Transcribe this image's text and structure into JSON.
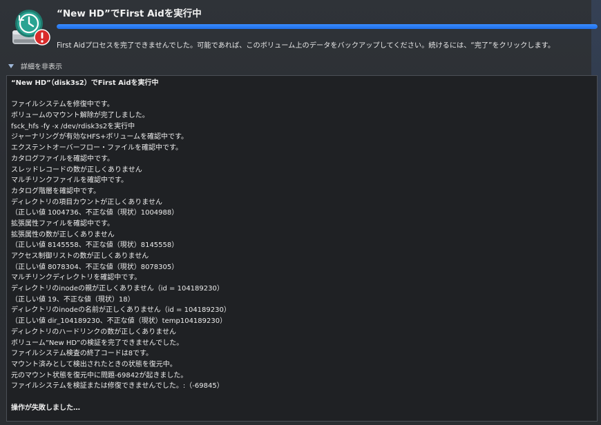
{
  "header": {
    "title": "“New HD”でFirst Aidを実行中",
    "progress_fraction": 1.0,
    "message": "First Aidプロセスを完了できませんでした。可能であれば、このボリューム上のデータをバックアップしてください。続けるには、“完了”をクリックします。",
    "icon": "disk-utility-time-machine-error-icon"
  },
  "colors": {
    "accent": "#2a7bff",
    "error": "#d92b2b",
    "background": "#2a2d31",
    "log_background": "#1f2124"
  },
  "details": {
    "toggle_label": "詳細を非表示"
  },
  "log": {
    "lines": [
      {
        "text": "“New HD”（disk3s2）でFirst Aidを実行中",
        "bold": true
      },
      {
        "text": "",
        "bold": false
      },
      {
        "text": "ファイルシステムを修復中です。",
        "bold": false
      },
      {
        "text": "ボリュームのマウント解除が完了しました。",
        "bold": false
      },
      {
        "text": "fsck_hfs -fy -x /dev/rdisk3s2を実行中",
        "bold": false
      },
      {
        "text": "ジャーナリングが有効なHFS+ボリュームを確認中です。",
        "bold": false
      },
      {
        "text": "エクステントオーバーフロー・ファイルを確認中です。",
        "bold": false
      },
      {
        "text": "カタログファイルを確認中です。",
        "bold": false
      },
      {
        "text": "スレッドレコードの数が正しくありません",
        "bold": false
      },
      {
        "text": "マルチリンクファイルを確認中です。",
        "bold": false
      },
      {
        "text": "カタログ階層を確認中です。",
        "bold": false
      },
      {
        "text": "ディレクトリの項目カウントが正しくありません",
        "bold": false
      },
      {
        "text": "（正しい値 1004736、不正な値（現状）1004988）",
        "bold": false
      },
      {
        "text": "拡張属性ファイルを確認中です。",
        "bold": false
      },
      {
        "text": "拡張属性の数が正しくありません",
        "bold": false
      },
      {
        "text": "（正しい値 8145558、不正な値（現状）8145558）",
        "bold": false
      },
      {
        "text": "アクセス制御リストの数が正しくありません",
        "bold": false
      },
      {
        "text": "（正しい値 8078304、不正な値（現状）8078305）",
        "bold": false
      },
      {
        "text": "マルチリンクディレクトリを確認中です。",
        "bold": false
      },
      {
        "text": "ディレクトリのinodeの親が正しくありません（id = 104189230）",
        "bold": false
      },
      {
        "text": "（正しい値 19、不正な値（現状）18）",
        "bold": false
      },
      {
        "text": "ディレクトリのinodeの名前が正しくありません（id = 104189230）",
        "bold": false
      },
      {
        "text": "（正しい値 dir_104189230、不正な値（現状）temp104189230）",
        "bold": false
      },
      {
        "text": "ディレクトリのハードリンクの数が正しくありません",
        "bold": false
      },
      {
        "text": "ボリューム”New HD”の検証を完了できませんでした。",
        "bold": false
      },
      {
        "text": "ファイルシステム検査の終了コードは8です。",
        "bold": false
      },
      {
        "text": "マウント済みとして検出されたときの状態を復元中。",
        "bold": false
      },
      {
        "text": "元のマウント状態を復元中に問題-69842が起きました。",
        "bold": false
      },
      {
        "text": "ファイルシステムを検証または修復できませんでした。:（-69845）",
        "bold": false
      },
      {
        "text": "",
        "bold": false
      },
      {
        "text": "操作が失敗しました…",
        "bold": true
      }
    ]
  }
}
